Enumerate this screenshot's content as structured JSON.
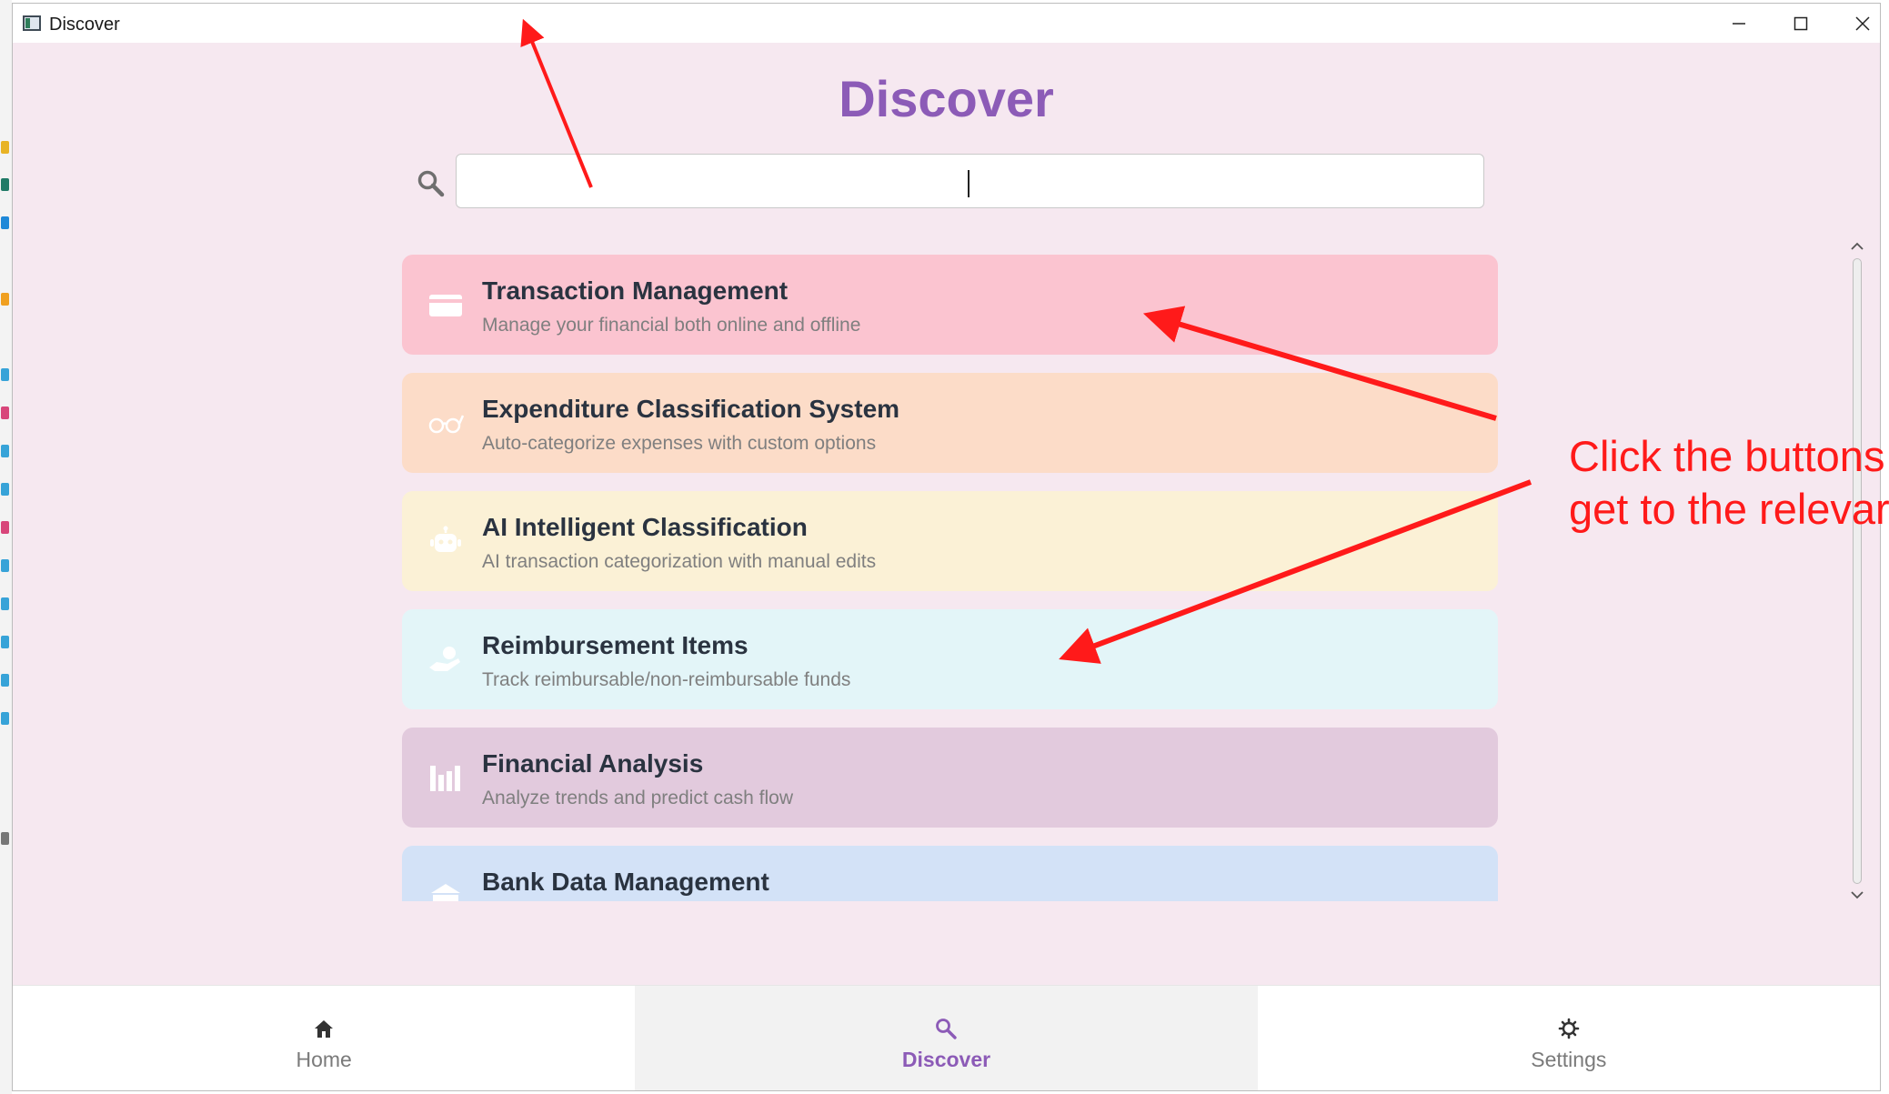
{
  "window": {
    "title": "Discover"
  },
  "page": {
    "title": "Discover"
  },
  "search": {
    "value": "",
    "placeholder": ""
  },
  "features": [
    {
      "title": "Transaction Management",
      "subtitle": "Manage your financial both online and offline",
      "color": "#fbc4d0",
      "icon": "card-icon"
    },
    {
      "title": "Expenditure Classification System",
      "subtitle": "Auto-categorize expenses with custom options",
      "color": "#fcdcc8",
      "icon": "glasses-icon"
    },
    {
      "title": "AI Intelligent Classification",
      "subtitle": "AI transaction categorization with manual edits",
      "color": "#fbf1d6",
      "icon": "robot-icon"
    },
    {
      "title": "Reimbursement Items",
      "subtitle": "Track reimbursable/non-reimbursable funds",
      "color": "#e3f5f8",
      "icon": "hand-money-icon"
    },
    {
      "title": "Financial Analysis",
      "subtitle": "Analyze trends and predict cash flow",
      "color": "#e2cadd",
      "icon": "bar-chart-icon"
    },
    {
      "title": "Bank Data Management",
      "subtitle": "",
      "color": "#d3e2f7",
      "icon": "bank-icon"
    }
  ],
  "nav": {
    "items": [
      {
        "label": "Home",
        "icon": "home-icon",
        "active": false
      },
      {
        "label": "Discover",
        "icon": "search-icon",
        "active": true
      },
      {
        "label": "Settings",
        "icon": "gear-icon",
        "active": false
      }
    ]
  },
  "annotation": {
    "lines": [
      "Click the buttons",
      "get to the relevar"
    ],
    "color": "#ff1a1a"
  },
  "colors": {
    "accent": "#8c5bb7",
    "background": "#f6e8f0"
  }
}
